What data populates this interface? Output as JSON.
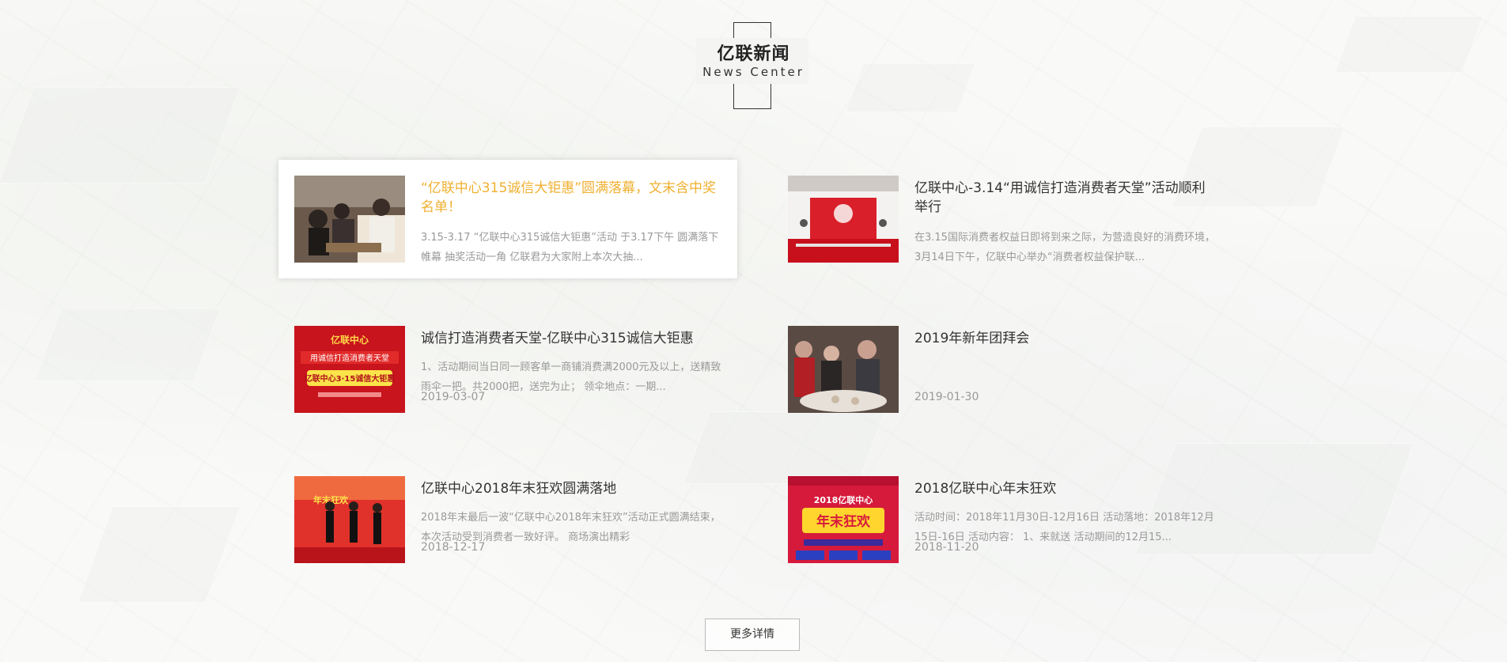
{
  "section": {
    "title": "亿联新闻",
    "subtitle": "News Center"
  },
  "news": [
    {
      "title": "“亿联中心315诚信大钜惠”圆满落幕，文末含中奖名单！",
      "desc": " 3.15-3.17 “亿联中心315诚信大钜惠”活动 于3.17下午 圆满落下帷幕 抽奖活动一角  亿联君为大家附上本次大抽...",
      "date": "",
      "thumb_icon": "event-photo-icon"
    },
    {
      "title": "亿联中心-3.14“用诚信打造消费者天堂”活动顺利举行",
      "desc": "在3.15国际消费者权益日即将到来之际，为营造良好的消费环境，3月14日下午，亿联中心举办“消费者权益保护联...",
      "date": "",
      "thumb_icon": "stage-photo-icon"
    },
    {
      "title": "诚信打造消费者天堂-亿联中心315诚信大钜惠",
      "desc": "1、活动期间当日同一顾客单一商铺消费满2000元及以上，送精致雨伞一把。共2000把，送完为止； 领伞地点：一期...",
      "date": "2019-03-07",
      "thumb_icon": "poster-photo-icon"
    },
    {
      "title": "2019年新年团拜会",
      "desc": "",
      "date": "2019-01-30",
      "thumb_icon": "banquet-photo-icon"
    },
    {
      "title": "亿联中心2018年末狂欢圆满落地",
      "desc": "2018年末最后一波“亿联中心2018年末狂欢”活动正式圆满结束， 本次活动受到消费者一致好评。  商场演出精彩",
      "date": "2018-12-17",
      "thumb_icon": "dance-photo-icon"
    },
    {
      "title": "2018亿联中心年末狂欢",
      "desc": "活动时间：2018年11月30日-12月16日 活动落地：2018年12月15日-16日 活动内容： 1、来就送 活动期间的12月15...",
      "date": "2018-11-20",
      "thumb_icon": "festival-poster-icon"
    }
  ],
  "thumb_text": {
    "poster_brand": "亿联中心",
    "poster_line1": "用诚信打造消费者天堂",
    "poster_line2": "亿联中心3·15诚信大钜惠",
    "festival_top": "2018亿联中心",
    "festival_main": "年末狂欢",
    "dance_banner": "年末狂欢"
  },
  "more_button": "更多详情",
  "colors": {
    "accent": "#f0b030",
    "text": "#333333",
    "muted": "#999999"
  }
}
